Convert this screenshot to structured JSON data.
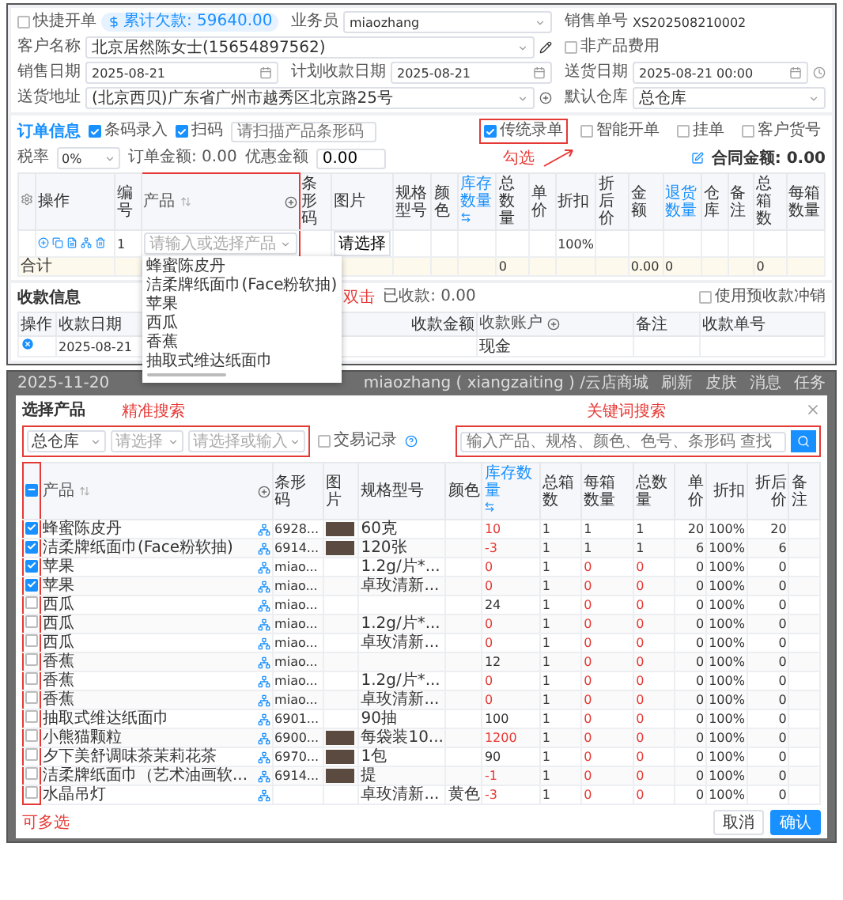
{
  "order_form": {
    "quick_order": {
      "label": "快捷开单",
      "checked": false
    },
    "debt_badge": "累计欠款: 59640.00",
    "salesperson": {
      "label": "业务员",
      "value": "miaozhang"
    },
    "order_no": {
      "label": "销售单号",
      "value": "XS202508210002"
    },
    "customer": {
      "label": "客户名称",
      "value": "北京居然陈女士(15654897562)"
    },
    "non_product_fee": {
      "label": "非产品费用",
      "checked": false
    },
    "sale_date": {
      "label": "销售日期",
      "value": "2025-08-21"
    },
    "plan_date": {
      "label": "计划收款日期",
      "value": "2025-08-21"
    },
    "delivery_date": {
      "label": "送货日期",
      "value": "2025-08-21 00:00"
    },
    "address": {
      "label": "送货地址",
      "value": "(北京西贝)广东省广州市越秀区北京路25号"
    },
    "warehouse": {
      "label": "默认仓库",
      "value": "总仓库"
    }
  },
  "order_info": {
    "title": "订单信息",
    "toggles": [
      {
        "label": "条码录入",
        "checked": true
      },
      {
        "label": "扫码",
        "checked": true
      }
    ],
    "scan_placeholder": "请扫描产品条形码",
    "modes": [
      {
        "label": "传统录单",
        "checked": true,
        "highlighted": true
      },
      {
        "label": "智能开单",
        "checked": false,
        "highlighted": false
      },
      {
        "label": "挂单",
        "checked": false,
        "highlighted": false
      },
      {
        "label": "客户货号",
        "checked": false,
        "highlighted": false
      }
    ],
    "tax": {
      "label": "税率",
      "value": "0%"
    },
    "order_amount": "订单金额: 0.00",
    "discount": {
      "label": "优惠金额",
      "value": "0.00"
    },
    "contract_amount": "合同金额: 0.00"
  },
  "order_table": {
    "columns": [
      {
        "kind": "settings"
      },
      {
        "kind": "plain",
        "label": "操作"
      },
      {
        "kind": "plain",
        "label": "编号"
      },
      {
        "kind": "product",
        "label": "产品"
      },
      {
        "kind": "plain",
        "label": "条形码"
      },
      {
        "kind": "plain",
        "label": "图片"
      },
      {
        "kind": "plain",
        "label": "规格型号"
      },
      {
        "kind": "plain",
        "label": "颜色"
      },
      {
        "kind": "link",
        "label": "库存数量"
      },
      {
        "kind": "plain",
        "label": "总数量"
      },
      {
        "kind": "plain",
        "label": "单价"
      },
      {
        "kind": "plain",
        "label": "折扣"
      },
      {
        "kind": "plain",
        "label": "折后价"
      },
      {
        "kind": "plain",
        "label": "金额"
      },
      {
        "kind": "link",
        "label": "退货数量"
      },
      {
        "kind": "plain",
        "label": "仓库"
      },
      {
        "kind": "plain",
        "label": "备注"
      },
      {
        "kind": "plain",
        "label": "总箱数"
      },
      {
        "kind": "plain",
        "label": "每箱数量"
      }
    ],
    "row": [
      {
        "kind": "empty"
      },
      {
        "kind": "actions"
      },
      {
        "kind": "text",
        "text": "1"
      },
      {
        "kind": "product_input",
        "placeholder": "请输入或选择产品"
      },
      {
        "kind": "empty"
      },
      {
        "kind": "button",
        "text": "请选择"
      },
      {
        "kind": "empty"
      },
      {
        "kind": "empty"
      },
      {
        "kind": "empty"
      },
      {
        "kind": "empty"
      },
      {
        "kind": "empty"
      },
      {
        "kind": "text",
        "text": "100%"
      },
      {
        "kind": "empty"
      },
      {
        "kind": "empty"
      },
      {
        "kind": "empty"
      },
      {
        "kind": "empty"
      },
      {
        "kind": "empty"
      },
      {
        "kind": "empty"
      },
      {
        "kind": "empty"
      }
    ],
    "total": {
      "label": "合计",
      "cells": [
        null,
        null,
        null,
        null,
        null,
        null,
        null,
        "0",
        null,
        null,
        null,
        "0.00",
        "0",
        null,
        null,
        "0",
        null
      ]
    }
  },
  "product_dropdown": [
    "蜂蜜陈皮丹",
    "洁柔牌纸面巾(Face粉软抽)",
    "苹果",
    "西瓜",
    "香蕉",
    "抽取式维达纸面巾"
  ],
  "receipt": {
    "title": "收款信息",
    "paid": "已收款: 0.00",
    "offset": {
      "label": "使用预收款冲销",
      "checked": false
    },
    "columns": [
      {
        "kind": "plain",
        "label": "操作"
      },
      {
        "kind": "plain",
        "label": "收款日期"
      },
      {
        "kind": "amount",
        "label": "收款金额"
      },
      {
        "kind": "account",
        "label": "收款账户"
      },
      {
        "kind": "plain",
        "label": "备注"
      },
      {
        "kind": "plain",
        "label": "收款单号"
      }
    ],
    "row": {
      "date": "2025-08-21",
      "account": "现金"
    }
  },
  "background_bar": {
    "date": "2025-11-20",
    "user": "miaozhang ( xiangzaiting ) /云店商城",
    "actions": [
      "刷新",
      "皮肤",
      "消息",
      "任务"
    ]
  },
  "dialog": {
    "title": "选择产品",
    "filters": {
      "warehouse": "总仓库",
      "select_placeholder": "请选择",
      "input_placeholder": "请选择或输入",
      "history": {
        "label": "交易记录",
        "checked": false
      },
      "search_placeholder": "输入产品、规格、颜色、色号、条形码 查找"
    },
    "select_all": {
      "indeterminate": true
    },
    "columns": [
      "产品",
      "条形码",
      "图片",
      "规格型号",
      "颜色",
      "库存数量",
      "总箱数",
      "每箱数量",
      "总数量",
      "单价",
      "折扣",
      "折后价",
      "备注"
    ],
    "rows": [
      {
        "checked": true,
        "name": "蜂蜜陈皮丹",
        "barcode": "6928...",
        "photo": true,
        "spec": "60克",
        "color_name": null,
        "stock": "10",
        "stock_low": true,
        "boxes": "1",
        "per_box": "1",
        "per_box_low": false,
        "qty": "1",
        "qty_low": false,
        "price": "20",
        "discount": "100%",
        "net": "20"
      },
      {
        "checked": true,
        "name": "洁柔牌纸面巾(Face粉软抽)",
        "barcode": "6914...",
        "photo": true,
        "spec": "120张",
        "color_name": null,
        "stock": "-3",
        "stock_low": true,
        "boxes": "1",
        "per_box": "1",
        "per_box_low": false,
        "qty": "1",
        "qty_low": false,
        "price": "6",
        "discount": "100%",
        "net": "6"
      },
      {
        "checked": true,
        "name": "苹果",
        "barcode": "miao...",
        "photo": false,
        "spec": "1.2g/片*...",
        "color_name": null,
        "stock": "0",
        "stock_low": true,
        "boxes": "1",
        "per_box": "0",
        "per_box_low": true,
        "qty": "0",
        "qty_low": true,
        "price": "0",
        "discount": "100%",
        "net": "0"
      },
      {
        "checked": true,
        "name": "苹果",
        "barcode": "miao...",
        "photo": false,
        "spec": "卓玫清新...",
        "color_name": null,
        "stock": "0",
        "stock_low": true,
        "boxes": "1",
        "per_box": "0",
        "per_box_low": true,
        "qty": "0",
        "qty_low": true,
        "price": "0",
        "discount": "100%",
        "net": "0"
      },
      {
        "checked": false,
        "name": "西瓜",
        "barcode": "miao...",
        "photo": false,
        "spec": null,
        "color_name": null,
        "stock": "24",
        "stock_low": false,
        "boxes": "1",
        "per_box": "0",
        "per_box_low": true,
        "qty": "0",
        "qty_low": true,
        "price": "0",
        "discount": "100%",
        "net": "0"
      },
      {
        "checked": false,
        "name": "西瓜",
        "barcode": "miao...",
        "photo": false,
        "spec": "1.2g/片*...",
        "color_name": null,
        "stock": "0",
        "stock_low": true,
        "boxes": "1",
        "per_box": "0",
        "per_box_low": true,
        "qty": "0",
        "qty_low": true,
        "price": "0",
        "discount": "100%",
        "net": "0"
      },
      {
        "checked": false,
        "name": "西瓜",
        "barcode": "miao...",
        "photo": false,
        "spec": "卓玫清新...",
        "color_name": null,
        "stock": "0",
        "stock_low": true,
        "boxes": "1",
        "per_box": "0",
        "per_box_low": true,
        "qty": "0",
        "qty_low": true,
        "price": "0",
        "discount": "100%",
        "net": "0"
      },
      {
        "checked": false,
        "name": "香蕉",
        "barcode": "miao...",
        "photo": false,
        "spec": null,
        "color_name": null,
        "stock": "12",
        "stock_low": false,
        "boxes": "1",
        "per_box": "0",
        "per_box_low": true,
        "qty": "0",
        "qty_low": true,
        "price": "0",
        "discount": "100%",
        "net": "0"
      },
      {
        "checked": false,
        "name": "香蕉",
        "barcode": "miao...",
        "photo": false,
        "spec": "1.2g/片*...",
        "color_name": null,
        "stock": "0",
        "stock_low": true,
        "boxes": "1",
        "per_box": "0",
        "per_box_low": true,
        "qty": "0",
        "qty_low": true,
        "price": "0",
        "discount": "100%",
        "net": "0"
      },
      {
        "checked": false,
        "name": "香蕉",
        "barcode": "miao...",
        "photo": false,
        "spec": "卓玫清新...",
        "color_name": null,
        "stock": "0",
        "stock_low": true,
        "boxes": "1",
        "per_box": "0",
        "per_box_low": true,
        "qty": "0",
        "qty_low": true,
        "price": "0",
        "discount": "100%",
        "net": "0"
      },
      {
        "checked": false,
        "name": "抽取式维达纸面巾",
        "barcode": "6901...",
        "photo": false,
        "spec": "90抽",
        "color_name": null,
        "stock": "100",
        "stock_low": false,
        "boxes": "1",
        "per_box": "0",
        "per_box_low": true,
        "qty": "0",
        "qty_low": true,
        "price": "0",
        "discount": "100%",
        "net": "0"
      },
      {
        "checked": false,
        "name": "小熊猫颗粒",
        "barcode": "6900...",
        "photo": true,
        "spec": "每袋装10...",
        "color_name": null,
        "stock": "1200",
        "stock_low": true,
        "boxes": "1",
        "per_box": "0",
        "per_box_low": true,
        "qty": "0",
        "qty_low": true,
        "price": "0",
        "discount": "100%",
        "net": "0"
      },
      {
        "checked": false,
        "name": "夕下美舒调味茶茉莉花茶",
        "barcode": "6970...",
        "photo": true,
        "spec": "1包",
        "color_name": null,
        "stock": "90",
        "stock_low": false,
        "boxes": "1",
        "per_box": "0",
        "per_box_low": true,
        "qty": "0",
        "qty_low": true,
        "price": "0",
        "discount": "100%",
        "net": "0"
      },
      {
        "checked": false,
        "name": "洁柔牌纸面巾（艺术油画软...",
        "barcode": "6914...",
        "photo": true,
        "spec": "提",
        "color_name": null,
        "stock": "-1",
        "stock_low": true,
        "boxes": "1",
        "per_box": "0",
        "per_box_low": true,
        "qty": "0",
        "qty_low": true,
        "price": "0",
        "discount": "100%",
        "net": "0"
      },
      {
        "checked": false,
        "name": "水晶吊灯",
        "barcode": null,
        "photo": false,
        "spec": "卓玫清新...",
        "color_name": "黄色",
        "stock": "-3",
        "stock_low": true,
        "boxes": "1",
        "per_box": "0",
        "per_box_low": true,
        "qty": "0",
        "qty_low": true,
        "price": "0",
        "discount": "100%",
        "net": "0"
      }
    ],
    "buttons": {
      "cancel": "取消",
      "confirm": "确认"
    }
  },
  "annotations": {
    "check": "勾选",
    "double_click": "双击",
    "exact_search": "精准搜索",
    "keyword_search": "关键词搜索",
    "multi_select": "可多选"
  }
}
